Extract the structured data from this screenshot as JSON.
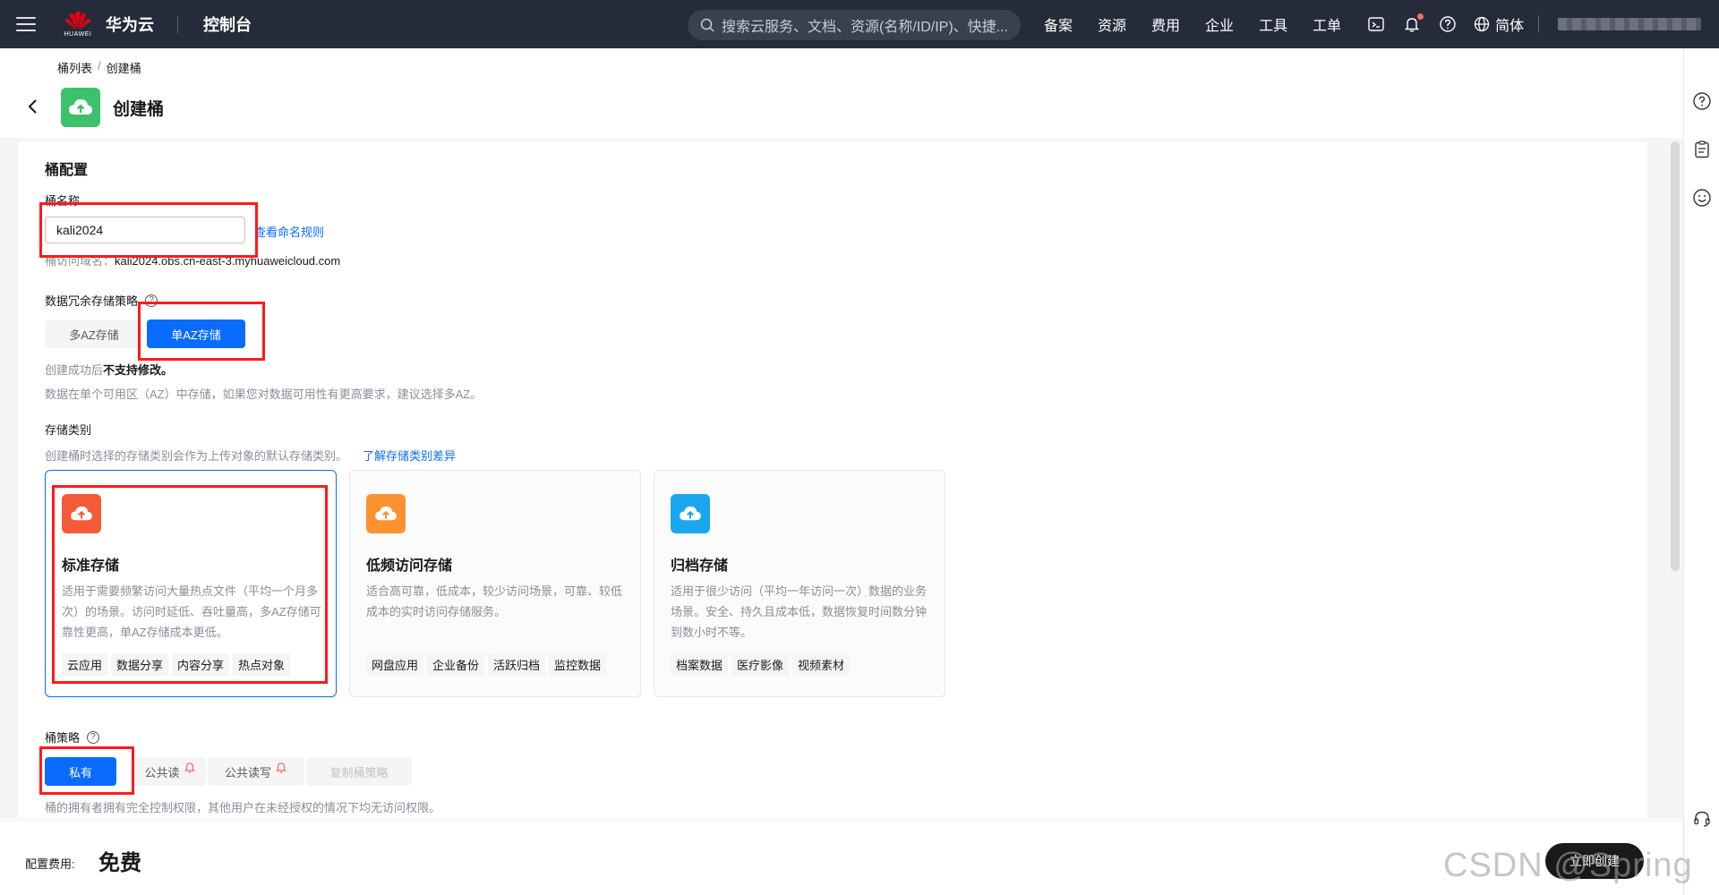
{
  "topnav": {
    "logo_sub": "HUAWEI",
    "brand": "华为云",
    "console": "控制台",
    "search_placeholder": "搜索云服务、文档、资源(名称/ID/IP)、快捷...",
    "items": [
      "备案",
      "资源",
      "费用",
      "企业",
      "工具",
      "工单"
    ],
    "lang": "简体"
  },
  "breadcrumb": {
    "parent": "桶列表",
    "sep": "/",
    "current": "创建桶"
  },
  "page": {
    "title": "创建桶"
  },
  "bucket_config": {
    "section_title": "桶配置",
    "name_label": "桶名称",
    "name_value": "kali2024",
    "naming_rule_link": "查看命名规则",
    "domain_label": "桶访问域名：",
    "domain_value": "kali2024.obs.cn-east-3.myhuaweicloud.com"
  },
  "redundancy": {
    "label": "数据冗余存储策略",
    "options": [
      "多AZ存储",
      "单AZ存储"
    ],
    "selected": "单AZ存储",
    "hint1_prefix": "创建成功后",
    "hint1_bold": "不支持修改。",
    "hint2": "数据在单个可用区（AZ）中存储，如果您对数据可用性有更高要求，建议选择多AZ。"
  },
  "storage_class": {
    "label": "存储类别",
    "hint": "创建桶时选择的存储类别会作为上传对象的默认存储类别。",
    "link": "了解存储类别差异",
    "cards": [
      {
        "title": "标准存储",
        "desc": "适用于需要频繁访问大量热点文件（平均一个月多次）的场景。访问时延低、吞吐量高，多AZ存储可靠性更高，单AZ存储成本更低。",
        "tags": [
          "云应用",
          "数据分享",
          "内容分享",
          "热点对象"
        ],
        "color": "#f25a38"
      },
      {
        "title": "低频访问存储",
        "desc": "适合高可靠，低成本，较少访问场景，可靠、较低成本的实时访问存储服务。",
        "tags": [
          "网盘应用",
          "企业备份",
          "活跃归档",
          "监控数据"
        ],
        "color": "#fa9231"
      },
      {
        "title": "归档存储",
        "desc": "适用于很少访问（平均一年访问一次）数据的业务场景。安全、持久且成本低，数据恢复时间数分钟到数小时不等。",
        "tags": [
          "档案数据",
          "医疗影像",
          "视频素材"
        ],
        "color": "#1aa7ee"
      }
    ]
  },
  "bucket_policy": {
    "label": "桶策略",
    "options": [
      "私有",
      "公共读",
      "公共读写",
      "复制桶策略"
    ],
    "selected": "私有",
    "hint": "桶的拥有者拥有完全控制权限，其他用户在未经授权的情况下均无访问权限。"
  },
  "footer": {
    "fee_label": "配置费用:",
    "fee_value": "免费",
    "create_button": "立即创建"
  },
  "watermark": "CSDN @Spring 胡",
  "colors": {
    "primary": "#0a6cff",
    "nav_bg": "#252b3a",
    "highlight": "#ff1a1a",
    "bucket_icon": "#3ec16b"
  }
}
